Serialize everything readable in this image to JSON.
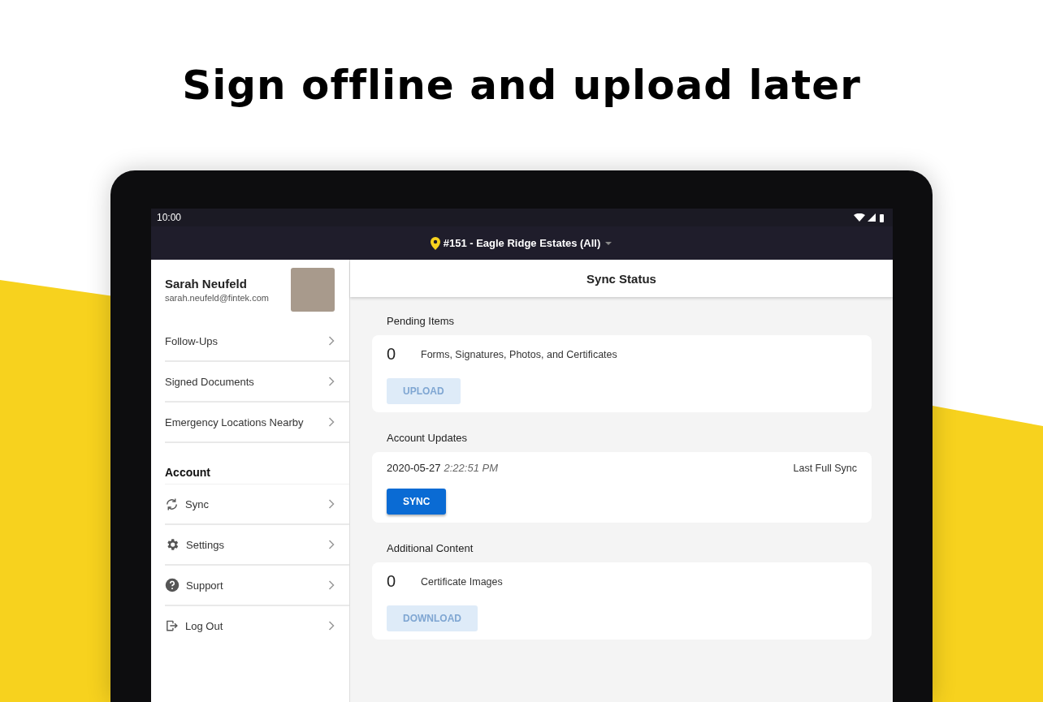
{
  "headline": "Sign offline and upload later",
  "status_bar": {
    "time": "10:00"
  },
  "location_bar": {
    "location": "#151 - Eagle Ridge Estates (All)"
  },
  "sidebar": {
    "user": {
      "name": "Sarah Neufeld",
      "email": "sarah.neufeld@fintek.com"
    },
    "items": [
      {
        "label": "Follow-Ups"
      },
      {
        "label": "Signed Documents"
      },
      {
        "label": "Emergency Locations Nearby"
      }
    ],
    "account": {
      "heading": "Account",
      "items": [
        {
          "label": "Sync"
        },
        {
          "label": "Settings"
        },
        {
          "label": "Support"
        },
        {
          "label": "Log Out"
        }
      ]
    }
  },
  "main": {
    "title": "Sync Status",
    "sections": [
      {
        "kind": "count",
        "heading": "Pending Items",
        "count": "0",
        "text": "Forms, Signatures, Photos, and Certificates",
        "button": {
          "label": "UPLOAD",
          "disabled": true
        }
      },
      {
        "kind": "sync",
        "heading": "Account Updates",
        "date": "2020-05-27",
        "time": "2:22:51 PM",
        "text": "Last Full Sync",
        "button": {
          "label": "SYNC",
          "disabled": false
        }
      },
      {
        "kind": "count",
        "heading": "Additional Content",
        "count": "0",
        "text": "Certificate Images",
        "button": {
          "label": "DOWNLOAD",
          "disabled": true
        }
      }
    ]
  }
}
